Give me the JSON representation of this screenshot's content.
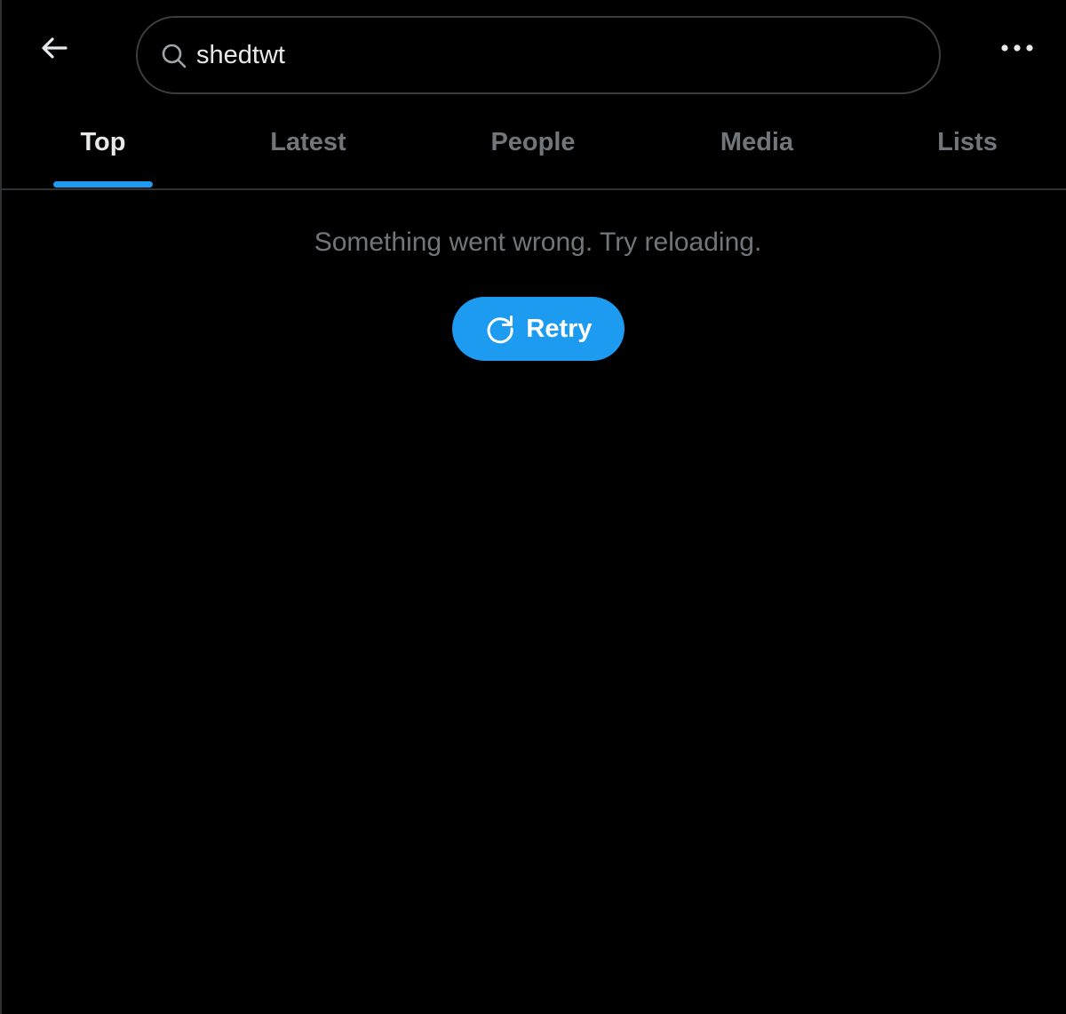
{
  "header": {
    "back_icon": "arrow-left-icon",
    "more_icon": "more-horizontal-icon",
    "search": {
      "value": "shedtwt",
      "icon": "search-icon"
    }
  },
  "tabs": [
    {
      "label": "Top",
      "active": true
    },
    {
      "label": "Latest",
      "active": false
    },
    {
      "label": "People",
      "active": false
    },
    {
      "label": "Media",
      "active": false
    },
    {
      "label": "Lists",
      "active": false
    }
  ],
  "error": {
    "message": "Something went wrong. Try reloading.",
    "retry_label": "Retry",
    "retry_icon": "refresh-icon"
  },
  "colors": {
    "background": "#000000",
    "accent": "#1d9bf0",
    "text_primary": "#e7e9ea",
    "text_secondary": "#71767b",
    "border": "#2f3336"
  }
}
